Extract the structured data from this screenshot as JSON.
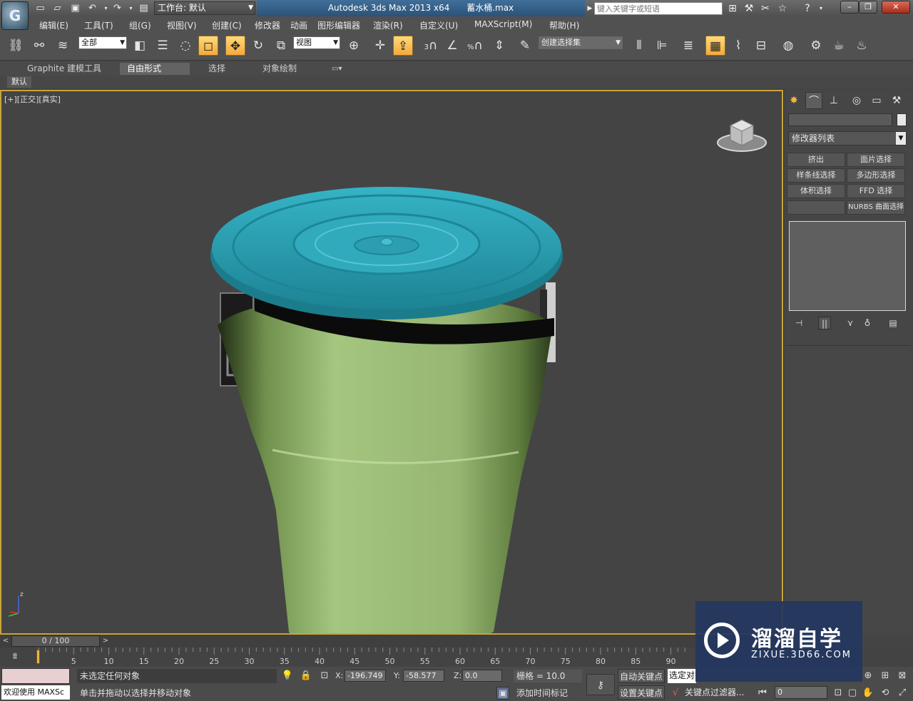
{
  "titlebar": {
    "workspace": "工作台: 默认",
    "app_title": "Autodesk 3ds Max  2013 x64",
    "file_name": "蓄水桶.max",
    "search_placeholder": "键入关键字或短语"
  },
  "menu": [
    "编辑(E)",
    "工具(T)",
    "组(G)",
    "视图(V)",
    "创建(C)",
    "修改器",
    "动画",
    "图形编辑器",
    "渲染(R)",
    "自定义(U)",
    "MAXScript(M)",
    "帮助(H)"
  ],
  "toolbar": {
    "selection_filter": "全部",
    "reference_coord": "视图",
    "named_selection_set": "创建选择集",
    "snap_3": "3",
    "snap_percent": "%"
  },
  "ribbon": {
    "tabs": [
      "Graphite 建模工具",
      "自由形式",
      "选择",
      "对象绘制"
    ],
    "active_tab": 1,
    "panel_label": "默认"
  },
  "viewport": {
    "label": "[+][正交][真实]",
    "axis_z": "z"
  },
  "command_panel": {
    "modifier_list": "修改器列表",
    "buttons": [
      "挤出",
      "面片选择",
      "样条线选择",
      "多边形选择",
      "体积选择",
      "FFD 选择",
      "",
      "NURBS 曲面选择"
    ]
  },
  "timeline": {
    "position_text": "0 / 100",
    "ticks": [
      "0",
      "5",
      "10",
      "15",
      "20",
      "25",
      "30",
      "35",
      "40",
      "45",
      "50",
      "55",
      "60",
      "65",
      "70",
      "75",
      "80",
      "85",
      "90"
    ]
  },
  "status": {
    "maxscript": "欢迎使用 MAXSc",
    "selection": "未选定任何对象",
    "prompt": "单击并拖动以选择并移动对象",
    "x_label": "X:",
    "x_value": "-196.749",
    "y_label": "Y:",
    "y_value": "-58.577",
    "z_label": "Z:",
    "z_value": "0.0",
    "grid": "栅格 = 10.0",
    "add_time_tag": "添加时间标记",
    "auto_key": "自动关键点",
    "set_key": "设置关键点",
    "selected": "选定对象",
    "key_filters": "关键点过滤器...",
    "frame": "0"
  },
  "watermark": {
    "title": "溜溜自学",
    "url": "ZIXUE.3D66.COM"
  },
  "colors": {
    "lid": "#2fa1b3",
    "body": "#9fbf7a",
    "viewport_border": "#c9a43a",
    "title_bar_blue": "#2c5277"
  }
}
